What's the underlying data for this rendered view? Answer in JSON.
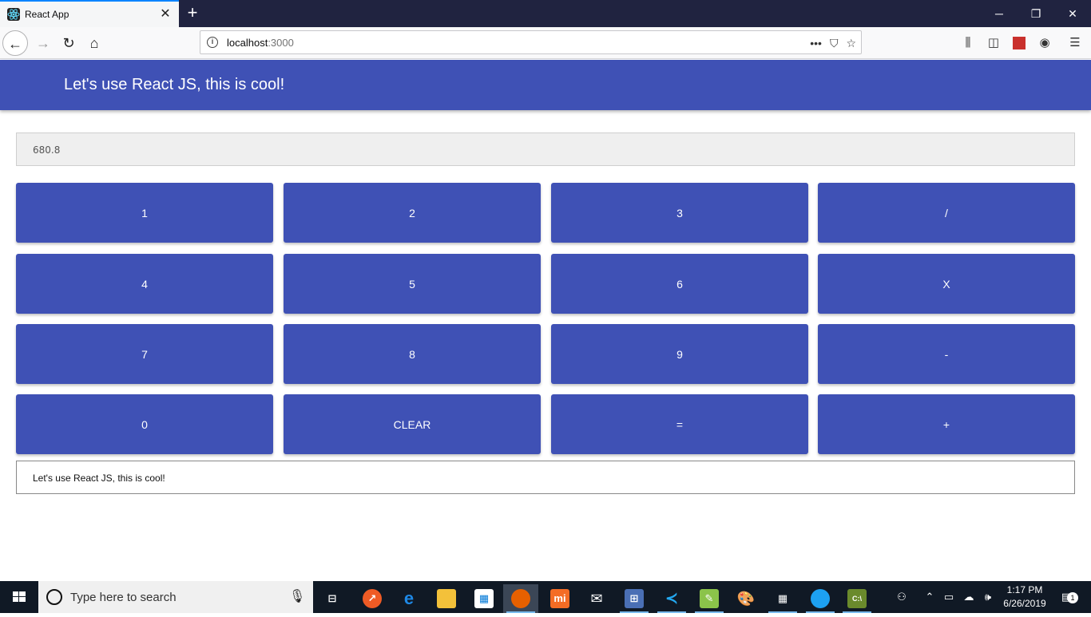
{
  "browser": {
    "tab_title": "React App",
    "url_host": "localhost",
    "url_port": ":3000"
  },
  "app": {
    "header_title": "Let's use React JS, this is cool!",
    "display_value": "680.8",
    "keys": [
      "1",
      "2",
      "3",
      "/",
      "4",
      "5",
      "6",
      "X",
      "7",
      "8",
      "9",
      "-",
      "0",
      "CLEAR",
      "=",
      "+"
    ],
    "message": "Let's use React JS, this is cool!"
  },
  "taskbar": {
    "search_placeholder": "Type here to search",
    "time": "1:17 PM",
    "date": "6/26/2019",
    "notification_count": "1"
  },
  "colors": {
    "primary": "#3f51b5",
    "tabbar": "#202340",
    "taskbar": "#101925"
  }
}
